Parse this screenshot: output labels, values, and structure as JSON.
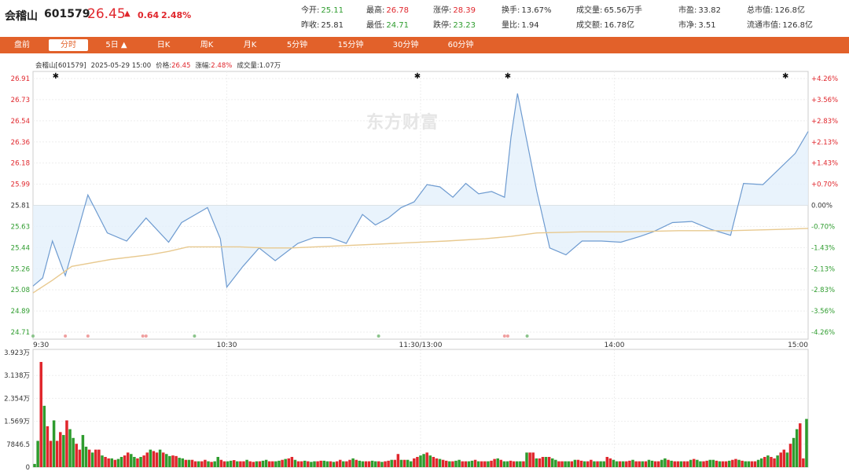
{
  "header": {
    "name": "会稽山",
    "code": "601579",
    "price": "26.45",
    "change": "0.64",
    "change_pct": "2.48%",
    "quotes": [
      {
        "label": "今开:",
        "value": "25.11",
        "color": "green"
      },
      {
        "label": "最高:",
        "value": "26.78",
        "color": "red"
      },
      {
        "label": "涨停:",
        "value": "28.39",
        "color": "red"
      },
      {
        "label": "换手:",
        "value": "13.67%",
        "color": "black"
      },
      {
        "label": "成交量:",
        "value": "65.56万手",
        "color": "black"
      },
      {
        "label": "市盈:",
        "value": "33.82",
        "color": "black"
      },
      {
        "label": "总市值:",
        "value": "126.8亿",
        "color": "black"
      },
      {
        "label": "昨收:",
        "value": "25.81",
        "color": "black"
      },
      {
        "label": "最低:",
        "value": "24.71",
        "color": "green"
      },
      {
        "label": "跌停:",
        "value": "23.23",
        "color": "green"
      },
      {
        "label": "量比:",
        "value": "1.94",
        "color": "black"
      },
      {
        "label": "成交额:",
        "value": "16.78亿",
        "color": "black"
      },
      {
        "label": "市净:",
        "value": "3.51",
        "color": "black"
      },
      {
        "label": "流通市值:",
        "value": "126.8亿",
        "color": "black"
      }
    ]
  },
  "tabs": [
    "盘前",
    "分时",
    "5日 ▲",
    "日K",
    "周K",
    "月K",
    "5分钟",
    "15分钟",
    "30分钟",
    "60分钟"
  ],
  "active_tab": 1,
  "info_line": {
    "title": "会稽山[601579]",
    "datetime": "2025-05-29 15:00",
    "price_label": "价格:",
    "price": "26.45",
    "change_label": "涨幅:",
    "change": "2.48%",
    "volume_label": "成交量:",
    "volume": "1.07万"
  },
  "watermark": "东方财富",
  "colors": {
    "accent": "#e2612a",
    "up": "#e0262c",
    "down": "#2e9c2e",
    "price_line": "#6e9bd0",
    "price_fill": "#e3f0fb",
    "avg_line": "#e8c98f"
  },
  "chart_data": [
    {
      "type": "line",
      "price_ticks": [
        "26.91",
        "26.73",
        "26.54",
        "26.36",
        "26.18",
        "25.99",
        "25.81",
        "25.63",
        "25.44",
        "25.26",
        "25.08",
        "24.89",
        "24.71"
      ],
      "pct_ticks": [
        "+4.26%",
        "+3.56%",
        "+2.83%",
        "+2.13%",
        "+1.43%",
        "+0.70%",
        "0.00%",
        "-0.70%",
        "-1.43%",
        "-2.13%",
        "-2.83%",
        "-3.56%",
        "-4.26%"
      ],
      "time_ticks": [
        "9:30",
        "10:30",
        "11:30/13:00",
        "14:00",
        "15:00"
      ],
      "ylim": [
        24.71,
        26.91
      ],
      "prev_close": 25.81,
      "x": [
        0,
        6,
        12,
        18,
        24,
        30,
        36,
        42,
        48,
        54,
        60,
        66,
        72,
        78,
        84,
        90,
        96,
        102,
        108,
        114,
        120,
        126,
        132,
        138,
        144,
        150,
        156,
        162,
        168,
        174,
        180,
        186,
        192,
        198,
        204,
        210,
        216,
        222,
        228,
        234,
        240
      ],
      "series": [
        {
          "values": [
            25.11,
            25.18,
            25.5,
            25.2,
            25.9,
            25.57,
            25.5,
            25.7,
            25.49,
            25.66,
            25.79,
            25.52,
            25.1,
            25.28,
            25.44,
            25.33,
            25.48,
            25.53,
            25.53,
            25.48,
            25.73,
            25.64,
            25.7,
            25.79,
            25.84,
            25.99,
            25.97,
            25.88,
            26.0,
            25.91,
            25.93,
            25.88,
            26.4,
            26.78,
            25.93,
            25.44,
            25.38,
            25.5,
            25.5,
            25.49,
            25.54,
            25.58,
            25.66,
            25.67,
            25.6,
            25.55,
            26.0,
            25.99,
            26.26,
            26.45
          ],
          "x": [
            0,
            3,
            6,
            10,
            17,
            23,
            29,
            35,
            42,
            46,
            54,
            58,
            60,
            65,
            70,
            75,
            82,
            87,
            92,
            97,
            102,
            106,
            110,
            114,
            118,
            122,
            126,
            130,
            134,
            138,
            142,
            146,
            148,
            150,
            156,
            160,
            165,
            170,
            176,
            182,
            188,
            192,
            198,
            204,
            210,
            216,
            220,
            226,
            236,
            240
          ]
        },
        {
          "name": "",
          "values": [
            25.05,
            25.16,
            25.28,
            25.34,
            25.38,
            25.41,
            25.45,
            25.45,
            25.45,
            25.44,
            25.44,
            25.46,
            25.48,
            25.5,
            25.52,
            25.54,
            25.57,
            25.58,
            25.58,
            25.59,
            25.59,
            25.6,
            25.61
          ],
          "x": [
            0,
            6,
            12,
            24,
            36,
            42,
            48,
            56,
            64,
            72,
            80,
            96,
            112,
            128,
            140,
            148,
            156,
            170,
            184,
            200,
            216,
            230,
            240
          ]
        }
      ]
    },
    {
      "type": "bar",
      "y_ticks": [
        "3.923万",
        "3.138万",
        "2.354万",
        "1.569万",
        "7846.5",
        "0"
      ],
      "ylim": [
        0,
        39230
      ],
      "values": [
        1100,
        9000,
        36000,
        21000,
        14000,
        9000,
        16000,
        9000,
        12000,
        11000,
        16000,
        13000,
        10000,
        8000,
        6000,
        11000,
        7000,
        6000,
        5000,
        6000,
        6000,
        4000,
        3500,
        3000,
        3000,
        2500,
        2800,
        3500,
        4000,
        5000,
        4500,
        3500,
        3000,
        3500,
        4000,
        5000,
        6000,
        5500,
        5000,
        6000,
        5000,
        4500,
        3800,
        4000,
        3800,
        3200,
        3000,
        2500,
        2500,
        2500,
        2000,
        2000,
        2000,
        2500,
        2000,
        1800,
        2000,
        3500,
        2500,
        2000,
        2000,
        2200,
        2400,
        2000,
        2000,
        2000,
        2500,
        2000,
        1800,
        2000,
        2000,
        2200,
        2500,
        2000,
        2000,
        2000,
        2200,
        2500,
        2800,
        3000,
        3500,
        2500,
        2000,
        2000,
        2200,
        2000,
        1800,
        2000,
        2000,
        2200,
        2200,
        2000,
        2000,
        1800,
        2000,
        2500,
        2000,
        2000,
        2500,
        3000,
        2500,
        2200,
        2000,
        2000,
        2000,
        2200,
        2000,
        2000,
        1800,
        2000,
        2200,
        2500,
        2500,
        4500,
        2500,
        2500,
        2500,
        2000,
        3000,
        3500,
        4000,
        4500,
        5000,
        4000,
        3500,
        3000,
        2800,
        2500,
        2200,
        2000,
        2000,
        2200,
        2500,
        2000,
        2000,
        2000,
        2200,
        2500,
        2000,
        2000,
        2000,
        2000,
        2200,
        2800,
        3000,
        2500,
        2000,
        2000,
        2200,
        2000,
        2000,
        2000,
        2000,
        5000,
        5000,
        5000,
        3000,
        3000,
        3500,
        3500,
        3500,
        3000,
        2500,
        2000,
        2000,
        2000,
        2000,
        2000,
        2500,
        2500,
        2200,
        2000,
        2000,
        2500,
        2000,
        2000,
        2000,
        2000,
        3500,
        3000,
        2500,
        2000,
        2000,
        2000,
        2000,
        2200,
        2500,
        2000,
        2000,
        2000,
        2000,
        2500,
        2200,
        2000,
        2000,
        2500,
        3000,
        2500,
        2200,
        2000,
        2000,
        2000,
        2000,
        2000,
        2500,
        2800,
        2500,
        2000,
        2000,
        2200,
        2500,
        2500,
        2200,
        2000,
        2000,
        2000,
        2200,
        2500,
        2800,
        2500,
        2200,
        2000,
        2000,
        2000,
        2000,
        2500,
        3000,
        3500,
        4000,
        3500,
        3000,
        4000,
        5000,
        6000,
        5000,
        8000,
        10000,
        13000,
        15000,
        3000,
        16500
      ],
      "colors": "mixed"
    }
  ]
}
